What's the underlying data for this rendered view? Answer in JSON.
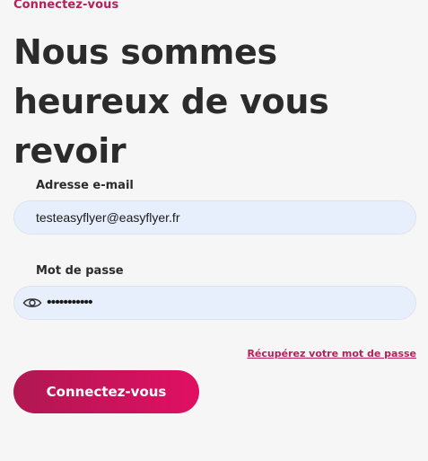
{
  "header": {
    "kicker": "Connectez-vous",
    "title": "Nous sommes heureux de vous revoir"
  },
  "form": {
    "email": {
      "label": "Adresse e-mail",
      "value": "testeasyflyer@easyflyer.fr"
    },
    "password": {
      "label": "Mot de passe",
      "value": "•••••••••••",
      "icon": "eye-icon"
    },
    "forgot_link": "Récupérez votre mot de passe",
    "submit_label": "Connectez-vous"
  },
  "colors": {
    "accent": "#b61f5a",
    "button_start": "#b01852",
    "button_end": "#e10f63",
    "input_bg": "#e8effc",
    "page_bg": "#f6f6f6",
    "text": "#2b2b2b"
  }
}
